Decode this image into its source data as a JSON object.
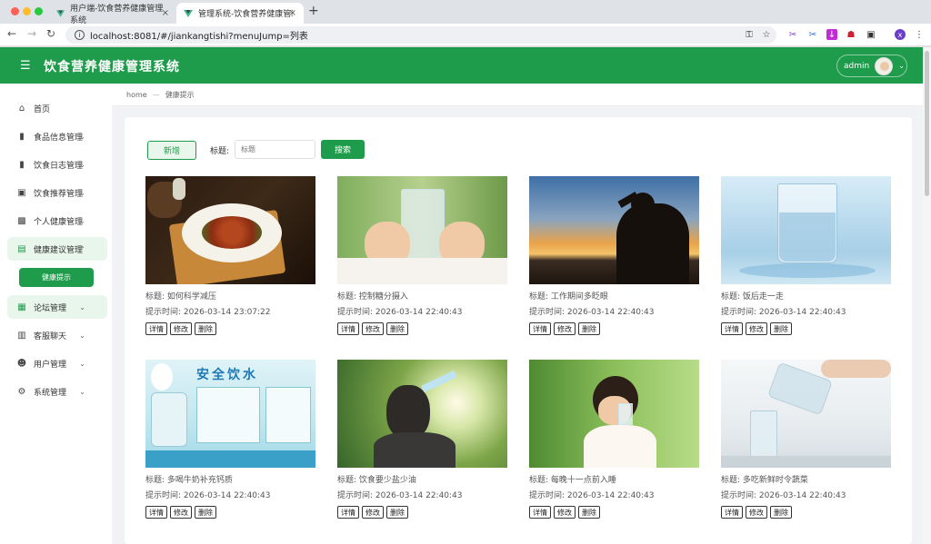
{
  "browser": {
    "tabs": [
      {
        "title": "用户端-饮食营养健康管理系统",
        "active": false
      },
      {
        "title": "管理系统-饮食营养健康管理系",
        "active": true
      }
    ],
    "url": "localhost:8081/#/jiankangtishi?menuJump=列表",
    "profile_letter": "x"
  },
  "header": {
    "title": "饮食营养健康管理系统",
    "user": "admin"
  },
  "sidebar": {
    "items": [
      {
        "label": "首页",
        "icon": "home-icon"
      },
      {
        "label": "食品信息管理",
        "icon": "book-icon"
      },
      {
        "label": "饮食日志管理",
        "icon": "book-icon"
      },
      {
        "label": "饮食推荐管理",
        "icon": "chip-icon"
      },
      {
        "label": "个人健康管理",
        "icon": "image-icon"
      },
      {
        "label": "健康建议管理",
        "icon": "panel-icon"
      },
      {
        "label": "论坛管理",
        "icon": "grid-icon"
      },
      {
        "label": "客服聊天",
        "icon": "sliders-icon"
      },
      {
        "label": "用户管理",
        "icon": "user-icon"
      },
      {
        "label": "系统管理",
        "icon": "settings-icon"
      }
    ],
    "sub_active": "健康提示"
  },
  "breadcrumb": {
    "home": "home",
    "current": "健康提示"
  },
  "toolbar": {
    "add_label": "新增",
    "search_label": "标题:",
    "search_placeholder": "标题",
    "search_button": "搜索"
  },
  "card_labels": {
    "title_prefix": "标题:",
    "time_prefix": "提示时间:",
    "detail": "详情",
    "edit": "修改",
    "delete": "删除"
  },
  "cards": [
    {
      "title": "如何科学减压",
      "time": "2026-03-14 23:07:22"
    },
    {
      "title": "控制糖分摄入",
      "time": "2026-03-14 22:40:43"
    },
    {
      "title": "工作期间多眨眼",
      "time": "2026-03-14 22:40:43"
    },
    {
      "title": "饭后走一走",
      "time": "2026-03-14 22:40:43"
    },
    {
      "title": "多喝牛奶补充钙质",
      "time": "2026-03-14 22:40:43"
    },
    {
      "title": "饮食要少盐少油",
      "time": "2026-03-14 22:40:43"
    },
    {
      "title": "每晚十一点前入睡",
      "time": "2026-03-14 22:40:43"
    },
    {
      "title": "多吃新鲜时令蔬菜",
      "time": "2026-03-14 22:40:43"
    }
  ],
  "poster": {
    "heading": "安全饮水"
  },
  "colors": {
    "primary": "#1e9b4b",
    "light_green": "#e8f6ec"
  }
}
